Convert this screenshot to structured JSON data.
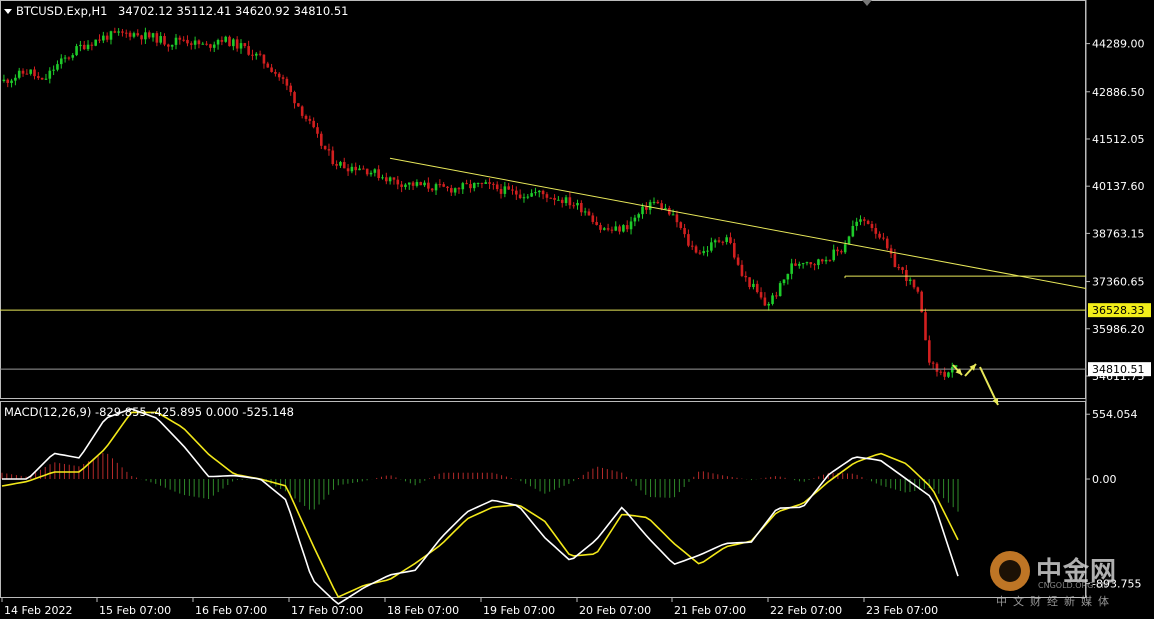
{
  "header": {
    "symbol_text": "BTCUSD.Exp,H1",
    "ohlc_text": "34702.12 35112.41 34620.92 34810.51"
  },
  "macd_header": {
    "text": "MACD(12,26,9) -829.855 -425.895 0.000 -525.148"
  },
  "price_axis_labels": [
    "44289.00",
    "42886.50",
    "41512.05",
    "40137.60",
    "38763.15",
    "37360.65",
    "35986.20",
    "34611.75"
  ],
  "macd_axis_labels": [
    "554.054",
    "0.00",
    "-893.755"
  ],
  "time_labels": [
    "14 Feb 2022",
    "15 Feb 07:00",
    "16 Feb 07:00",
    "17 Feb 07:00",
    "18 Feb 07:00",
    "19 Feb 07:00",
    "20 Feb 07:00",
    "21 Feb 07:00",
    "22 Feb 07:00",
    "23 Feb 07:00"
  ],
  "level_badge": "36528.33",
  "price_badge": "34810.51",
  "watermark": {
    "name": "中金网",
    "url": "CNGOLD.ORG.CN",
    "tagline": "中文财经新媒体"
  },
  "colors": {
    "bull": "#1ecb2a",
    "bear": "#d11f1f",
    "trendline": "#e8e85a",
    "macd_line": "#ffffff",
    "signal_line": "#f2e81a",
    "hist_pos": "#b52a2a",
    "hist_neg": "#2f8a2a",
    "badge": "#f2ee1a"
  },
  "chart_data": {
    "type": "candlestick",
    "symbol": "BTCUSD.Exp",
    "timeframe": "H1",
    "last_ohlc": {
      "open": 34702.12,
      "high": 35112.41,
      "low": 34620.92,
      "close": 34810.51
    },
    "y_range": [
      34000,
      45500
    ],
    "price_path": [
      43200,
      43350,
      43500,
      43150,
      43600,
      43900,
      44200,
      44350,
      44500,
      44550,
      44600,
      44520,
      44450,
      44300,
      44450,
      44300,
      44200,
      44450,
      44300,
      44150,
      43900,
      43600,
      43200,
      42600,
      42000,
      41350,
      40850,
      40700,
      40700,
      40550,
      40400,
      40250,
      40200,
      40150,
      40100,
      40050,
      40100,
      40150,
      40150,
      40050,
      39950,
      39900,
      39950,
      39850,
      39750,
      39600,
      39400,
      38900,
      38850,
      38950,
      39300,
      39700,
      39500,
      39100,
      38400,
      38200,
      38500,
      38700,
      37600,
      37200,
      36650,
      37100,
      37800,
      38000,
      37900,
      38100,
      38300,
      39050,
      39150,
      38700,
      37950,
      37550,
      36950,
      34900,
      34650,
      34810
    ],
    "annotations": {
      "horizontal_levels": [
        36528.33,
        37520
      ],
      "trendline": {
        "start": 40950,
        "end": 37160
      },
      "current_price": 34810.51
    },
    "macd": {
      "params": "12,26,9",
      "values": {
        "main": -829.855,
        "signal": -425.895,
        "third": 0.0,
        "fourth": -525.148
      },
      "y_range": [
        -1000,
        650
      ],
      "macd_line": [
        0,
        0,
        220,
        180,
        520,
        600,
        520,
        290,
        20,
        30,
        0,
        -180,
        -860,
        -1070,
        -930,
        -820,
        -780,
        -500,
        -280,
        -180,
        -230,
        -500,
        -700,
        -520,
        -240,
        -500,
        -730,
        -650,
        -550,
        -540,
        -250,
        -240,
        40,
        190,
        160,
        0,
        -160,
        -830
      ],
      "signal_line": [
        -60,
        -20,
        60,
        60,
        260,
        570,
        570,
        440,
        210,
        40,
        0,
        -60,
        -550,
        -1010,
        -910,
        -860,
        -720,
        -560,
        -340,
        -240,
        -220,
        -360,
        -660,
        -640,
        -300,
        -330,
        -550,
        -730,
        -580,
        -530,
        -280,
        -210,
        -20,
        140,
        220,
        130,
        -80,
        -520
      ]
    }
  }
}
